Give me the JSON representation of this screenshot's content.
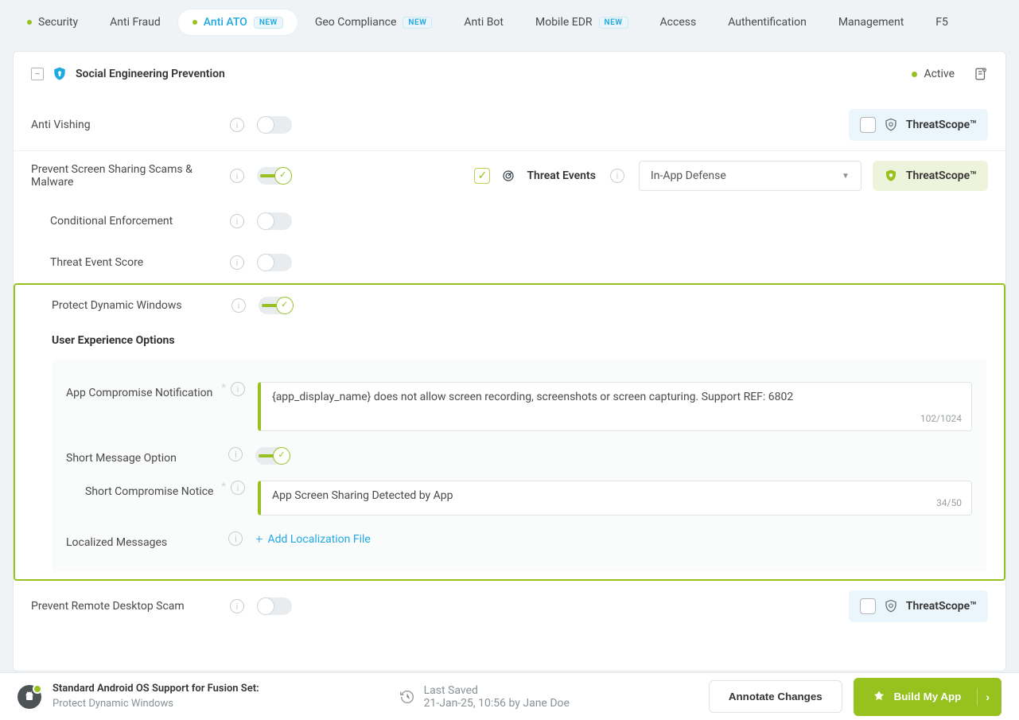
{
  "tabs": {
    "security": "Security",
    "anti_fraud": "Anti Fraud",
    "anti_ato": "Anti ATO",
    "geo": "Geo Compliance",
    "anti_bot": "Anti Bot",
    "mobile_edr": "Mobile EDR",
    "access": "Access",
    "auth": "Authentification",
    "mgmt": "Management",
    "f5": "F5",
    "new": "NEW"
  },
  "card": {
    "title": "Social Engineering Prevention",
    "status": "Active"
  },
  "threatscope": "ThreatScope™",
  "rows": {
    "anti_vishing": "Anti Vishing",
    "prevent_screen": "Prevent Screen Sharing Scams & Malware",
    "threat_events": "Threat Events",
    "defense_option": "In-App Defense",
    "conditional": "Conditional Enforcement",
    "score": "Threat Event Score",
    "protect_dyn": "Protect Dynamic Windows",
    "ux_heading": "User Experience Options",
    "app_comp": "App Compromise Notification",
    "app_comp_text": "{app_display_name} does not allow screen recording, screenshots or screen capturing. Support REF: 6802",
    "app_comp_count": "102/1024",
    "short_opt": "Short Message Option",
    "short_notice": "Short Compromise Notice",
    "short_notice_text": "App Screen Sharing Detected by App",
    "short_notice_count": "34/50",
    "localized": "Localized Messages",
    "add_local": "Add Localization File",
    "prevent_remote": "Prevent Remote Desktop Scam"
  },
  "footer": {
    "line1": "Standard Android OS Support for Fusion Set:",
    "line2": "Protect Dynamic Windows",
    "saved_label": "Last Saved",
    "saved_detail": "21-Jan-25, 10:56 by Jane Doe",
    "annotate": "Annotate Changes",
    "build": "Build My App"
  }
}
